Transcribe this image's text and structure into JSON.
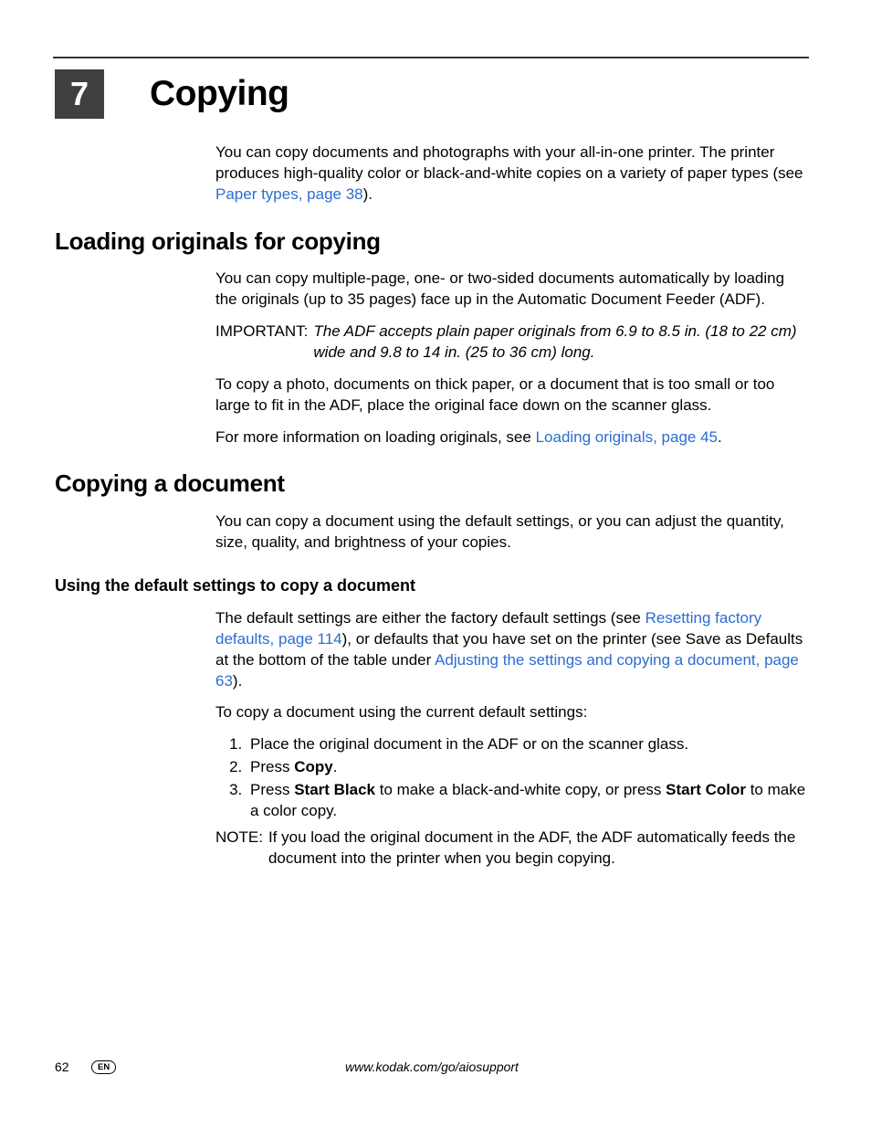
{
  "chapter": {
    "number": "7",
    "title": "Copying"
  },
  "intro": {
    "p1a": "You can copy documents and photographs with your all-in-one printer. The printer produces high-quality color or black-and-white copies on a variety of paper types (see ",
    "p1link": "Paper types, page 38",
    "p1b": ")."
  },
  "loading": {
    "heading": "Loading originals for copying",
    "p1": "You can copy multiple-page, one- or two-sided documents automatically by loading the originals (up to 35 pages) face up in the Automatic Document Feeder (ADF).",
    "important_label": "IMPORTANT:",
    "important_text": "The ADF accepts plain paper originals from 6.9 to 8.5 in. (18 to 22 cm) wide and 9.8 to 14 in. (25 to 36 cm) long.",
    "p2": "To copy a photo, documents on thick paper, or a document that is too small or too large to fit in the ADF, place the original face down on the scanner glass.",
    "p3a": "For more information on loading originals, see ",
    "p3link": "Loading originals, page 45",
    "p3b": "."
  },
  "copying_doc": {
    "heading": "Copying a document",
    "p1": "You can copy a document using the default settings, or you can adjust the quantity, size, quality, and brightness of your copies."
  },
  "defaults": {
    "heading": "Using the default settings to copy a document",
    "p1a": "The default settings are either the factory default settings (see ",
    "p1link1": "Resetting factory defaults, page 114",
    "p1b": "), or defaults that you have set on the printer (see Save as Defaults at the bottom of the table under ",
    "p1link2": "Adjusting the settings and copying a document, page 63",
    "p1c": ").",
    "p2": "To copy a document using the current default settings:",
    "step1": "Place the original document in the ADF or on the scanner glass.",
    "step2a": "Press ",
    "step2b_bold": "Copy",
    "step2c": ".",
    "step3a": "Press ",
    "step3b_bold": "Start Black",
    "step3c": " to make a black-and-white copy, or press ",
    "step3d_bold": "Start Color",
    "step3e": " to make a color copy.",
    "note_label": "NOTE:",
    "note_text": "If you load the original document in the ADF, the ADF automatically feeds the document into the printer when you begin copying."
  },
  "footer": {
    "page": "62",
    "lang": "EN",
    "url": "www.kodak.com/go/aiosupport"
  }
}
